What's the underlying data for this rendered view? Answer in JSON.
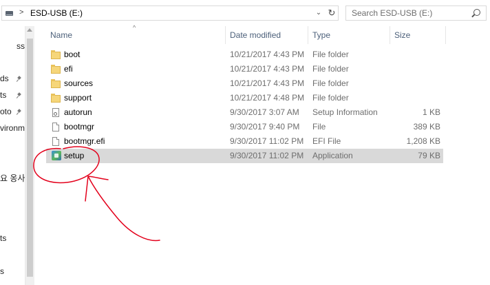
{
  "address_bar": {
    "separator": ">",
    "location": "ESD-USB (E:)",
    "dropdown_glyph": "⌄",
    "refresh_glyph": "↻"
  },
  "search": {
    "placeholder": "Search ESD-USB (E:)"
  },
  "nav_pane": {
    "items": [
      {
        "label": "ss",
        "pinned": false
      },
      {
        "label": "ds",
        "pinned": true
      },
      {
        "label": "ts",
        "pinned": true
      },
      {
        "label": "oto",
        "pinned": true
      },
      {
        "label": "vironm",
        "pinned": false
      },
      {
        "label": "요 옹사",
        "pinned": false
      },
      {
        "label": "ts",
        "pinned": false
      },
      {
        "label": "s",
        "pinned": false
      }
    ]
  },
  "columns": {
    "name": "Name",
    "date_modified": "Date modified",
    "type": "Type",
    "size": "Size"
  },
  "files": [
    {
      "name": "boot",
      "date": "10/21/2017 4:43 PM",
      "type": "File folder",
      "size": "",
      "icon": "folder-icon",
      "selected": false
    },
    {
      "name": "efi",
      "date": "10/21/2017 4:43 PM",
      "type": "File folder",
      "size": "",
      "icon": "folder-icon",
      "selected": false
    },
    {
      "name": "sources",
      "date": "10/21/2017 4:43 PM",
      "type": "File folder",
      "size": "",
      "icon": "folder-icon",
      "selected": false
    },
    {
      "name": "support",
      "date": "10/21/2017 4:48 PM",
      "type": "File folder",
      "size": "",
      "icon": "folder-icon",
      "selected": false
    },
    {
      "name": "autorun",
      "date": "9/30/2017 3:07 AM",
      "type": "Setup Information",
      "size": "1 KB",
      "icon": "setup-info-icon",
      "selected": false
    },
    {
      "name": "bootmgr",
      "date": "9/30/2017 9:40 PM",
      "type": "File",
      "size": "389 KB",
      "icon": "file-icon",
      "selected": false
    },
    {
      "name": "bootmgr.efi",
      "date": "9/30/2017 11:02 PM",
      "type": "EFI File",
      "size": "1,208 KB",
      "icon": "file-icon",
      "selected": false
    },
    {
      "name": "setup",
      "date": "9/30/2017 11:02 PM",
      "type": "Application",
      "size": "79 KB",
      "icon": "application-icon",
      "selected": true
    }
  ],
  "colors": {
    "selection": "#d9d9d9",
    "header_text": "#4c607a",
    "annotation": "#e3001b"
  }
}
